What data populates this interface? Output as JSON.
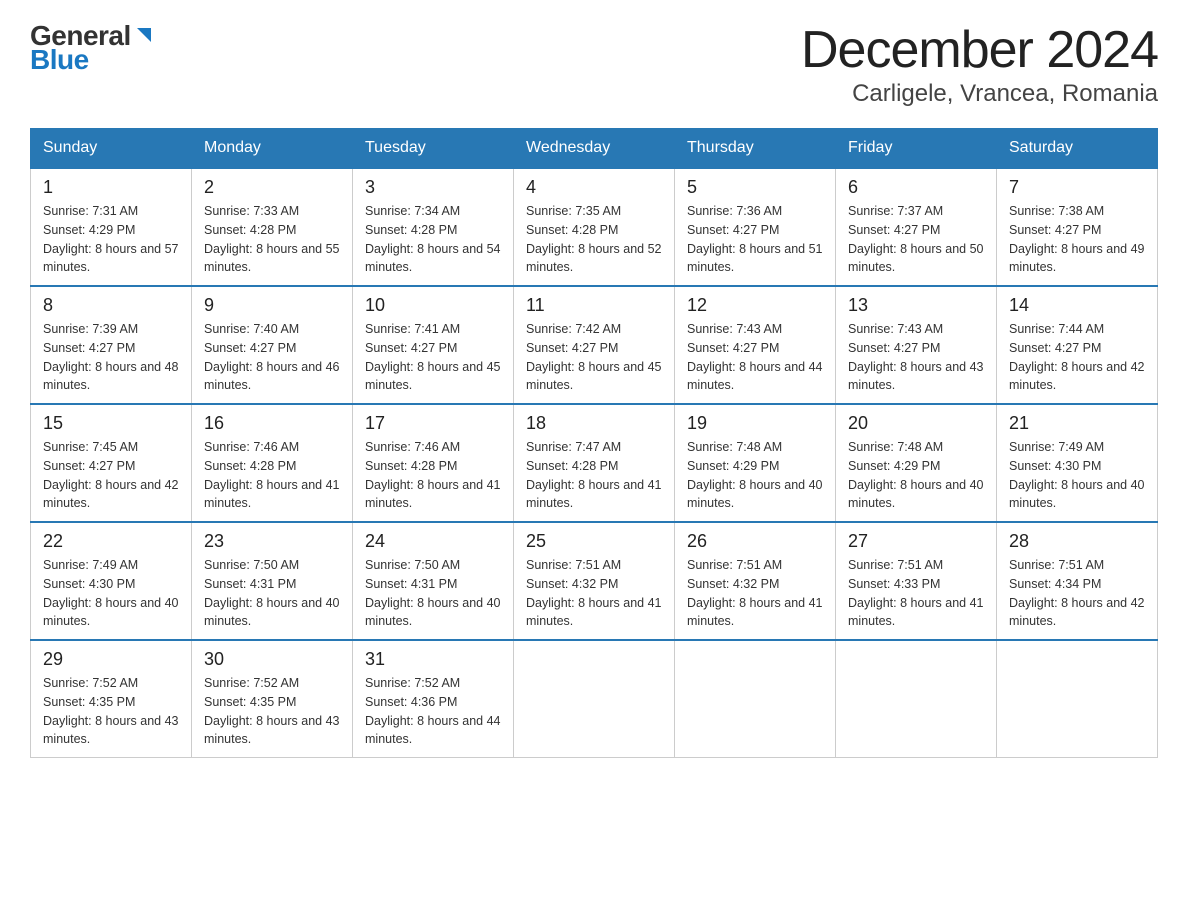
{
  "logo": {
    "general": "General",
    "blue": "Blue"
  },
  "title": {
    "month_year": "December 2024",
    "location": "Carligele, Vrancea, Romania"
  },
  "headers": [
    "Sunday",
    "Monday",
    "Tuesday",
    "Wednesday",
    "Thursday",
    "Friday",
    "Saturday"
  ],
  "weeks": [
    [
      {
        "day": 1,
        "sunrise": "7:31 AM",
        "sunset": "4:29 PM",
        "daylight": "8 hours and 57 minutes."
      },
      {
        "day": 2,
        "sunrise": "7:33 AM",
        "sunset": "4:28 PM",
        "daylight": "8 hours and 55 minutes."
      },
      {
        "day": 3,
        "sunrise": "7:34 AM",
        "sunset": "4:28 PM",
        "daylight": "8 hours and 54 minutes."
      },
      {
        "day": 4,
        "sunrise": "7:35 AM",
        "sunset": "4:28 PM",
        "daylight": "8 hours and 52 minutes."
      },
      {
        "day": 5,
        "sunrise": "7:36 AM",
        "sunset": "4:27 PM",
        "daylight": "8 hours and 51 minutes."
      },
      {
        "day": 6,
        "sunrise": "7:37 AM",
        "sunset": "4:27 PM",
        "daylight": "8 hours and 50 minutes."
      },
      {
        "day": 7,
        "sunrise": "7:38 AM",
        "sunset": "4:27 PM",
        "daylight": "8 hours and 49 minutes."
      }
    ],
    [
      {
        "day": 8,
        "sunrise": "7:39 AM",
        "sunset": "4:27 PM",
        "daylight": "8 hours and 48 minutes."
      },
      {
        "day": 9,
        "sunrise": "7:40 AM",
        "sunset": "4:27 PM",
        "daylight": "8 hours and 46 minutes."
      },
      {
        "day": 10,
        "sunrise": "7:41 AM",
        "sunset": "4:27 PM",
        "daylight": "8 hours and 45 minutes."
      },
      {
        "day": 11,
        "sunrise": "7:42 AM",
        "sunset": "4:27 PM",
        "daylight": "8 hours and 45 minutes."
      },
      {
        "day": 12,
        "sunrise": "7:43 AM",
        "sunset": "4:27 PM",
        "daylight": "8 hours and 44 minutes."
      },
      {
        "day": 13,
        "sunrise": "7:43 AM",
        "sunset": "4:27 PM",
        "daylight": "8 hours and 43 minutes."
      },
      {
        "day": 14,
        "sunrise": "7:44 AM",
        "sunset": "4:27 PM",
        "daylight": "8 hours and 42 minutes."
      }
    ],
    [
      {
        "day": 15,
        "sunrise": "7:45 AM",
        "sunset": "4:27 PM",
        "daylight": "8 hours and 42 minutes."
      },
      {
        "day": 16,
        "sunrise": "7:46 AM",
        "sunset": "4:28 PM",
        "daylight": "8 hours and 41 minutes."
      },
      {
        "day": 17,
        "sunrise": "7:46 AM",
        "sunset": "4:28 PM",
        "daylight": "8 hours and 41 minutes."
      },
      {
        "day": 18,
        "sunrise": "7:47 AM",
        "sunset": "4:28 PM",
        "daylight": "8 hours and 41 minutes."
      },
      {
        "day": 19,
        "sunrise": "7:48 AM",
        "sunset": "4:29 PM",
        "daylight": "8 hours and 40 minutes."
      },
      {
        "day": 20,
        "sunrise": "7:48 AM",
        "sunset": "4:29 PM",
        "daylight": "8 hours and 40 minutes."
      },
      {
        "day": 21,
        "sunrise": "7:49 AM",
        "sunset": "4:30 PM",
        "daylight": "8 hours and 40 minutes."
      }
    ],
    [
      {
        "day": 22,
        "sunrise": "7:49 AM",
        "sunset": "4:30 PM",
        "daylight": "8 hours and 40 minutes."
      },
      {
        "day": 23,
        "sunrise": "7:50 AM",
        "sunset": "4:31 PM",
        "daylight": "8 hours and 40 minutes."
      },
      {
        "day": 24,
        "sunrise": "7:50 AM",
        "sunset": "4:31 PM",
        "daylight": "8 hours and 40 minutes."
      },
      {
        "day": 25,
        "sunrise": "7:51 AM",
        "sunset": "4:32 PM",
        "daylight": "8 hours and 41 minutes."
      },
      {
        "day": 26,
        "sunrise": "7:51 AM",
        "sunset": "4:32 PM",
        "daylight": "8 hours and 41 minutes."
      },
      {
        "day": 27,
        "sunrise": "7:51 AM",
        "sunset": "4:33 PM",
        "daylight": "8 hours and 41 minutes."
      },
      {
        "day": 28,
        "sunrise": "7:51 AM",
        "sunset": "4:34 PM",
        "daylight": "8 hours and 42 minutes."
      }
    ],
    [
      {
        "day": 29,
        "sunrise": "7:52 AM",
        "sunset": "4:35 PM",
        "daylight": "8 hours and 43 minutes."
      },
      {
        "day": 30,
        "sunrise": "7:52 AM",
        "sunset": "4:35 PM",
        "daylight": "8 hours and 43 minutes."
      },
      {
        "day": 31,
        "sunrise": "7:52 AM",
        "sunset": "4:36 PM",
        "daylight": "8 hours and 44 minutes."
      },
      null,
      null,
      null,
      null
    ]
  ]
}
